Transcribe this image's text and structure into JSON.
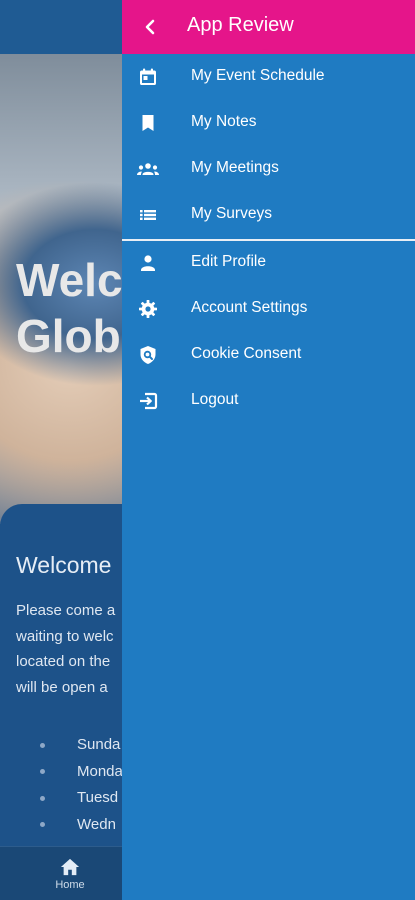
{
  "background": {
    "hero_title": "Welc\nGlob",
    "card_title": "Welcome",
    "card_lines": [
      "Please come a",
      "waiting to welc",
      "located on the",
      "will be open a"
    ],
    "days": [
      "Sunda",
      "Monda",
      "Tuesd",
      "Wedn"
    ],
    "bottom_nav": {
      "home_label": "Home"
    }
  },
  "drawer": {
    "title": "App Review",
    "back_icon": "chevron-left-icon",
    "items": [
      {
        "label": "My Event Schedule",
        "icon": "calendar-icon"
      },
      {
        "label": "My Notes",
        "icon": "bookmark-icon"
      },
      {
        "label": "My Meetings",
        "icon": "people-icon"
      },
      {
        "label": "My Surveys",
        "icon": "list-icon"
      },
      {
        "label": "Edit Profile",
        "icon": "person-icon"
      },
      {
        "label": "Account Settings",
        "icon": "gear-icon"
      },
      {
        "label": "Cookie Consent",
        "icon": "shield-search-icon"
      },
      {
        "label": "Logout",
        "icon": "logout-icon"
      }
    ]
  },
  "colors": {
    "header_accent": "#e5158a",
    "drawer_bg": "#1f7bc2",
    "app_bg": "#1d5289"
  }
}
